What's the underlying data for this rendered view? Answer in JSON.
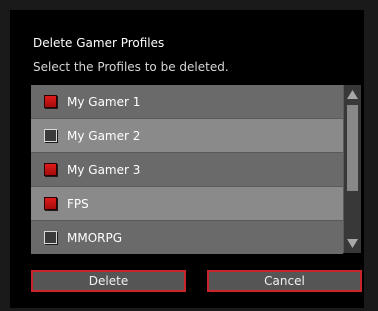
{
  "dialog": {
    "title": "Delete Gamer Profiles",
    "subtitle": "Select the Profiles to be deleted."
  },
  "profiles": [
    {
      "label": "My Gamer 1",
      "selected": true
    },
    {
      "label": "My Gamer 2",
      "selected": false
    },
    {
      "label": "My Gamer 3",
      "selected": true
    },
    {
      "label": "FPS",
      "selected": true
    },
    {
      "label": "MMORPG",
      "selected": false
    }
  ],
  "buttons": {
    "delete_label": "Delete",
    "cancel_label": "Cancel"
  },
  "icons": {
    "scroll_up": "scroll-up-arrow-icon",
    "scroll_down": "scroll-down-arrow-icon",
    "checkbox_on": "checked-checkbox-icon",
    "checkbox_off": "unchecked-checkbox-icon"
  },
  "colors": {
    "accent": "#c8242a",
    "check_on": "#e01b1b",
    "background": "#000000"
  }
}
